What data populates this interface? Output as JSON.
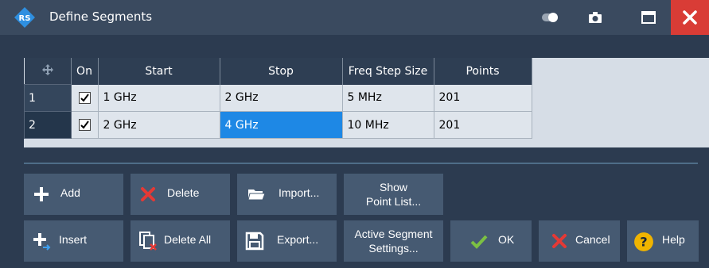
{
  "window": {
    "title": "Define Segments"
  },
  "table": {
    "headers": [
      "On",
      "Start",
      "Stop",
      "Freq Step Size",
      "Points"
    ],
    "rows": [
      {
        "num": "1",
        "on": true,
        "start": "1 GHz",
        "stop": "2 GHz",
        "step": "5 MHz",
        "points": "201"
      },
      {
        "num": "2",
        "on": true,
        "start": "2 GHz",
        "stop": "4 GHz",
        "step": "10 MHz",
        "points": "201"
      }
    ]
  },
  "buttons": {
    "add": "Add",
    "delete": "Delete",
    "import": "Import...",
    "show_point_list_1": "Show",
    "show_point_list_2": "Point List...",
    "insert": "Insert",
    "delete_all": "Delete All",
    "export": "Export...",
    "active_segment_1": "Active Segment",
    "active_segment_2": "Settings...",
    "ok": "OK",
    "cancel": "Cancel",
    "help": "Help"
  },
  "colors": {
    "accent": "#1e88e5",
    "close": "#d93c36",
    "ok": "#7cc043",
    "cancel": "#e53935",
    "help": "#f0b400"
  }
}
